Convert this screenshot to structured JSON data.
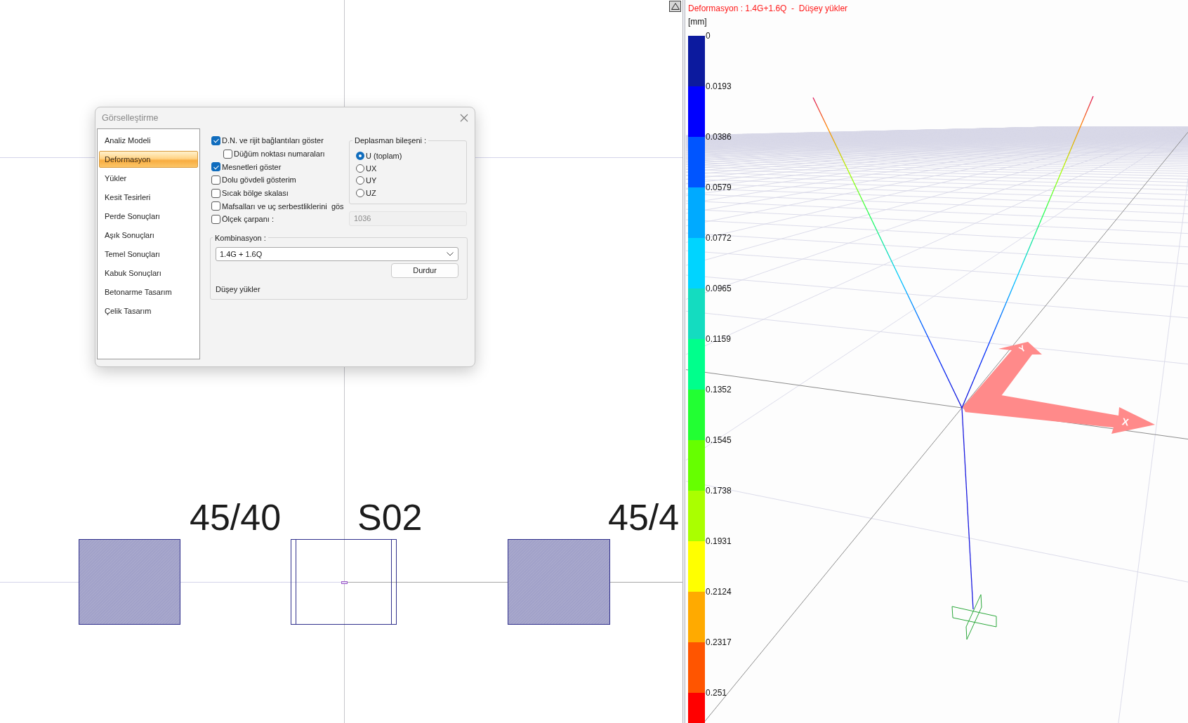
{
  "left_view": {
    "sections": [
      {
        "kind": "column",
        "label": "45/40"
      },
      {
        "kind": "wall",
        "label": "S02"
      },
      {
        "kind": "column",
        "label": "45/4"
      }
    ]
  },
  "dialog": {
    "title": "Görselleştirme",
    "sidebar": {
      "items": [
        {
          "label": "Analiz Modeli",
          "selected": false
        },
        {
          "label": "Deformasyon",
          "selected": true
        },
        {
          "label": "Yükler",
          "selected": false
        },
        {
          "label": "Kesit Tesirleri",
          "selected": false
        },
        {
          "label": "Perde Sonuçları",
          "selected": false
        },
        {
          "label": "Aşık Sonuçları",
          "selected": false
        },
        {
          "label": "Temel Sonuçları",
          "selected": false
        },
        {
          "label": "Kabuk Sonuçları",
          "selected": false
        },
        {
          "label": "Betonarme Tasarım",
          "selected": false
        },
        {
          "label": "Çelik Tasarım",
          "selected": false
        }
      ]
    },
    "options": [
      {
        "label": "D.N. ve rijit bağlantıları göster",
        "checked": true,
        "children": [
          {
            "label": "Düğüm noktası numaraları",
            "checked": false
          }
        ]
      },
      {
        "label": "Mesnetleri göster",
        "checked": true
      },
      {
        "label": "Dolu gövdeli gösterim",
        "checked": false
      },
      {
        "label": "Sıcak bölge skalası",
        "checked": false
      },
      {
        "label": "Mafsalları ve uç serbestliklerini  gös",
        "checked": false
      },
      {
        "label": "Ölçek çarpanı :",
        "checked": false
      }
    ],
    "displacement": {
      "title": "Deplasman bileşeni :",
      "options": [
        {
          "label": "U (toplam)",
          "selected": true
        },
        {
          "label": "UX",
          "selected": false
        },
        {
          "label": "UY",
          "selected": false
        },
        {
          "label": "UZ",
          "selected": false
        }
      ]
    },
    "scale_field": {
      "value": "1036",
      "disabled": true
    },
    "combination": {
      "title": "Kombinasyon :",
      "value": "1.4G + 1.6Q",
      "button": "Durdur",
      "description": "Düşey yükler"
    }
  },
  "right_view": {
    "title": "Deformasyon : 1.4G+1.6Q  -  Düşey yükler",
    "legend": {
      "unit": "[mm]",
      "bands": [
        {
          "label": "0",
          "color": "#0c1a9e"
        },
        {
          "label": "0.0193",
          "color": "#0000ff"
        },
        {
          "label": "0.0386",
          "color": "#0055ff"
        },
        {
          "label": "0.0579",
          "color": "#00aaff"
        },
        {
          "label": "0.0772",
          "color": "#00d4ff"
        },
        {
          "label": "0.0965",
          "color": "#14dcc0"
        },
        {
          "label": "0.1159",
          "color": "#00ff8c"
        },
        {
          "label": "0.1352",
          "color": "#22ff33"
        },
        {
          "label": "0.1545",
          "color": "#66ff00"
        },
        {
          "label": "0.1738",
          "color": "#aaff00"
        },
        {
          "label": "0.1931",
          "color": "#ffff00"
        },
        {
          "label": "0.2124",
          "color": "#ffaa00"
        },
        {
          "label": "0.2317",
          "color": "#ff5500"
        },
        {
          "label": "0.251",
          "color": "#ff0000"
        }
      ]
    },
    "axes": [
      {
        "kind": "y",
        "label": "Y"
      },
      {
        "kind": "x",
        "label": "X"
      }
    ]
  }
}
